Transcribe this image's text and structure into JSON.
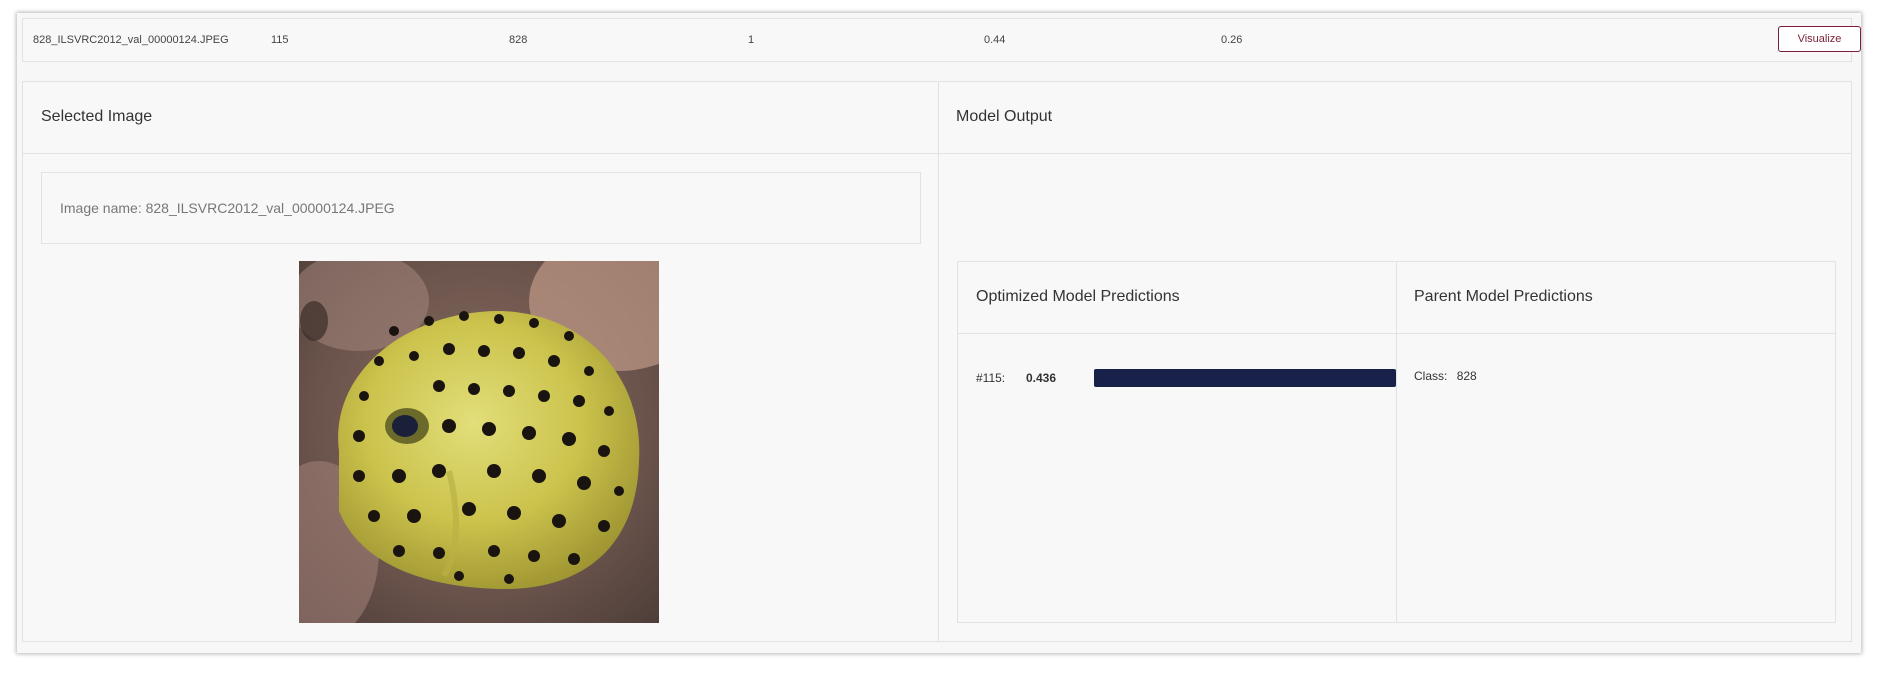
{
  "results_row": {
    "image_name": "828_ILSVRC2012_val_00000124.JPEG",
    "col2": "115",
    "col3": "828",
    "col4": "1",
    "col5": "0.44",
    "col6": "0.26",
    "visualize_label": "Visualize"
  },
  "selected_image": {
    "title": "Selected Image",
    "image_name_label": "Image name:",
    "image_name_value": "828_ILSVRC2012_val_00000124.JPEG"
  },
  "model_output": {
    "title": "Model Output",
    "optimized": {
      "title": "Optimized Model Predictions",
      "predictions": [
        {
          "class_label": "#115:",
          "score": "0.436",
          "fraction": 1.0
        }
      ]
    },
    "parent": {
      "title": "Parent Model Predictions",
      "class_label": "Class:",
      "class_value": "828"
    }
  },
  "colors": {
    "accent": "#7a1f35",
    "bar": "#18214a",
    "fish_yellow": "#c9c24a"
  }
}
